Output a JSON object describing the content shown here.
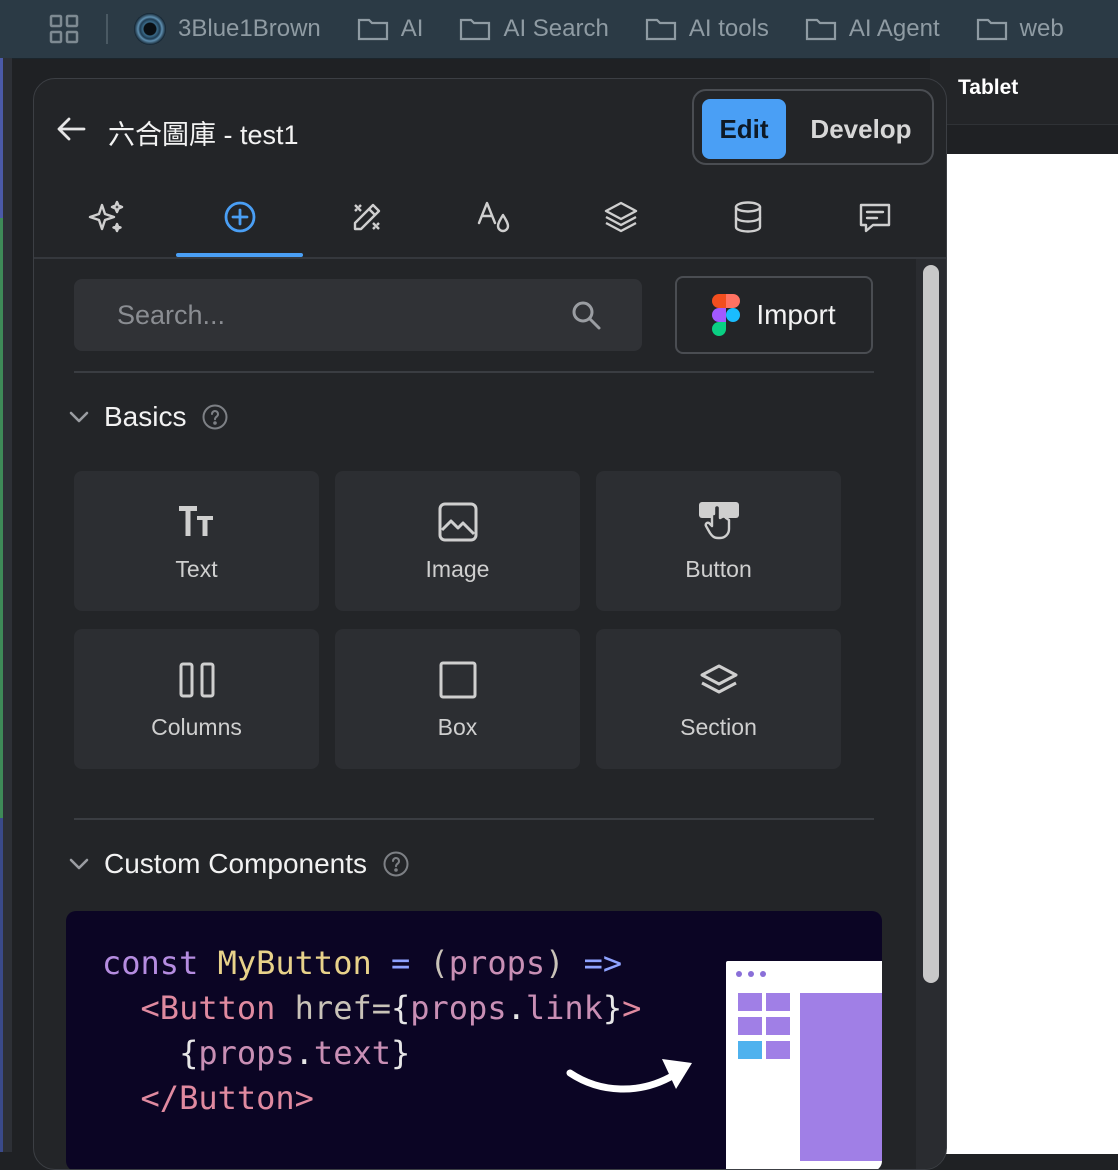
{
  "bookmarks": {
    "items": [
      {
        "label": "3Blue1Brown",
        "icon": "3blue1brown-logo"
      },
      {
        "label": "AI",
        "icon": "folder-icon"
      },
      {
        "label": "AI Search",
        "icon": "folder-icon"
      },
      {
        "label": "AI tools",
        "icon": "folder-icon"
      },
      {
        "label": "AI Agent",
        "icon": "folder-icon"
      },
      {
        "label": "web",
        "icon": "folder-icon"
      }
    ]
  },
  "canvas": {
    "device_label": "Tablet"
  },
  "header": {
    "title": "六合圖庫 - test1",
    "edit_label": "Edit",
    "develop_label": "Develop"
  },
  "tabs": [
    {
      "name": "ai-sparkle",
      "icon": "sparkles-icon",
      "active": false
    },
    {
      "name": "insert",
      "icon": "plus-circle-icon",
      "active": true
    },
    {
      "name": "design",
      "icon": "pencil-ruler-icon",
      "active": false
    },
    {
      "name": "theme",
      "icon": "typography-drop-icon",
      "active": false
    },
    {
      "name": "layers",
      "icon": "layers-icon",
      "active": false
    },
    {
      "name": "data",
      "icon": "database-icon",
      "active": false
    },
    {
      "name": "comments",
      "icon": "message-icon",
      "active": false
    }
  ],
  "search": {
    "placeholder": "Search..."
  },
  "import": {
    "label": "Import"
  },
  "basics": {
    "title": "Basics",
    "items": [
      {
        "label": "Text",
        "icon": "text-size-icon"
      },
      {
        "label": "Image",
        "icon": "image-icon"
      },
      {
        "label": "Button",
        "icon": "button-pointer-icon"
      },
      {
        "label": "Columns",
        "icon": "columns-icon"
      },
      {
        "label": "Box",
        "icon": "box-icon"
      },
      {
        "label": "Section",
        "icon": "section-layers-icon"
      }
    ]
  },
  "custom_components": {
    "title": "Custom Components",
    "code": {
      "line1_kw": "const",
      "line1_name": "MyButton",
      "line1_eq": "=",
      "line1_paren_open": "(",
      "line1_arg": "props",
      "line1_paren_close": ")",
      "line1_arrow": "=>",
      "line2_tag_open": "<Button",
      "line2_attr": "href=",
      "line2_brace_open": "{",
      "line2_obj": "props",
      "line2_dot": ".",
      "line2_prop": "link",
      "line2_brace_close": "}",
      "line2_gt": ">",
      "line3_brace_open": "{",
      "line3_obj": "props",
      "line3_dot": ".",
      "line3_prop": "text",
      "line3_brace_close": "}",
      "line4_tag_close": "</Button>"
    }
  },
  "colors": {
    "accent": "#4a9ff5",
    "panel_bg": "#232528",
    "card_bg": "#2c2e32",
    "banner_bg": "#0b0524",
    "mock_purple": "#a07fe6",
    "mock_blue": "#4fb2ee"
  }
}
